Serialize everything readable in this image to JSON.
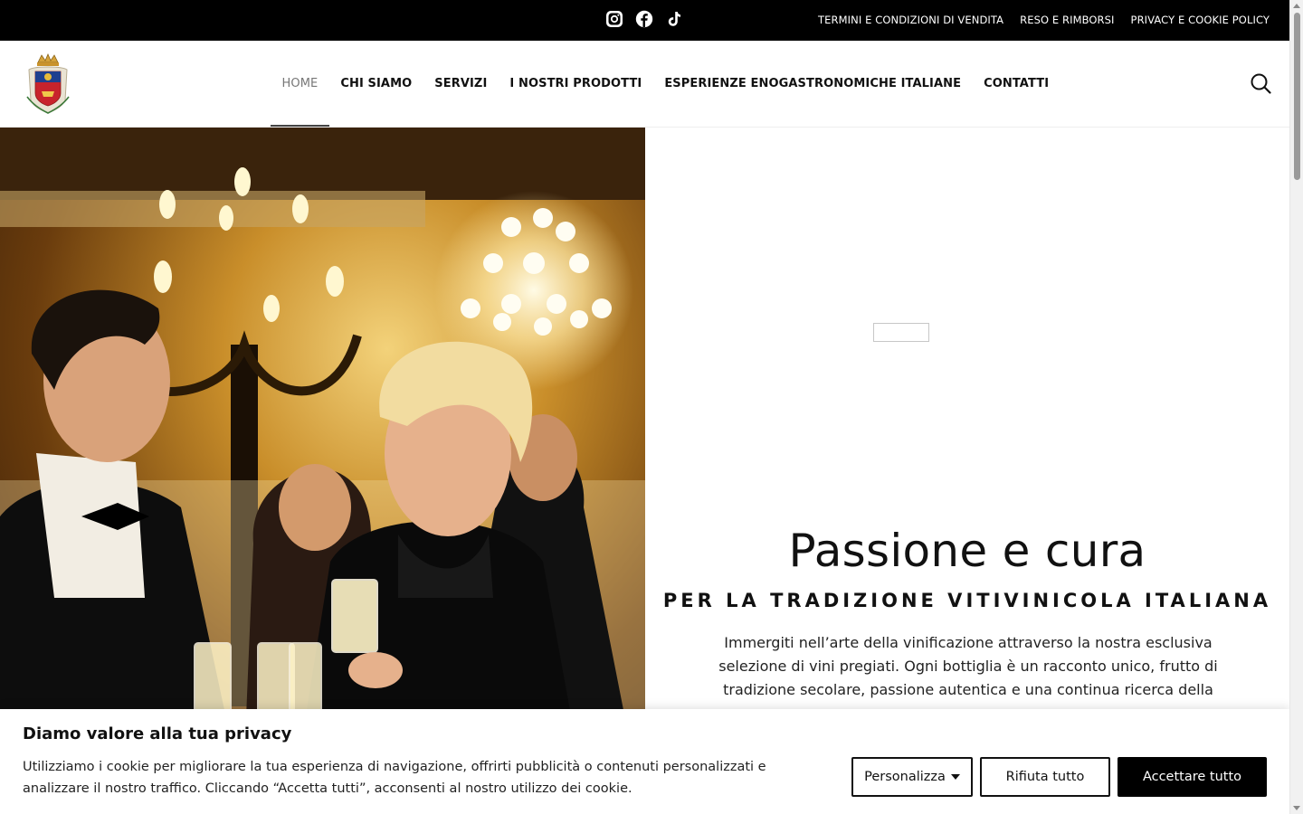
{
  "topbar": {
    "social_icons": [
      "instagram-icon",
      "facebook-icon",
      "tiktok-icon"
    ],
    "links": [
      "TERMINI E CONDIZIONI DI VENDITA",
      "RESO E RIMBORSI",
      "PRIVACY E COOKIE POLICY"
    ]
  },
  "header": {
    "nav": [
      {
        "label": "HOME",
        "active": true
      },
      {
        "label": "CHI SIAMO"
      },
      {
        "label": "SERVIZI"
      },
      {
        "label": "I NOSTRI PRODOTTI"
      },
      {
        "label": "ESPERIENZE ENOGASTRONOMICHE ITALIANE"
      },
      {
        "label": "CONTATTI"
      }
    ]
  },
  "main": {
    "title": "Passione e cura",
    "subtitle": "PER LA TRADIZIONE VITIVINICOLA ITALIANA",
    "body": "Immergiti nell’arte della vinificazione attraverso la nostra esclusiva selezione di vini pregiati. Ogni bottiglia è un racconto unico, frutto di tradizione secolare, passione autentica e una continua ricerca della"
  },
  "cookie": {
    "title": "Diamo valore alla tua privacy",
    "text": "Utilizziamo i cookie per migliorare la tua esperienza di navigazione, offrirti pubblicità o contenuti personalizzati e analizzare il nostro traffico. Cliccando “Accetta tutti”, acconsenti al nostro utilizzo dei cookie.",
    "customize_label": "Personalizza",
    "reject_label": "Rifiuta tutto",
    "accept_label": "Accettare tutto"
  },
  "colors": {
    "topbar_bg": "#000000",
    "accept_bg": "#000000",
    "active_nav": "#777777"
  }
}
